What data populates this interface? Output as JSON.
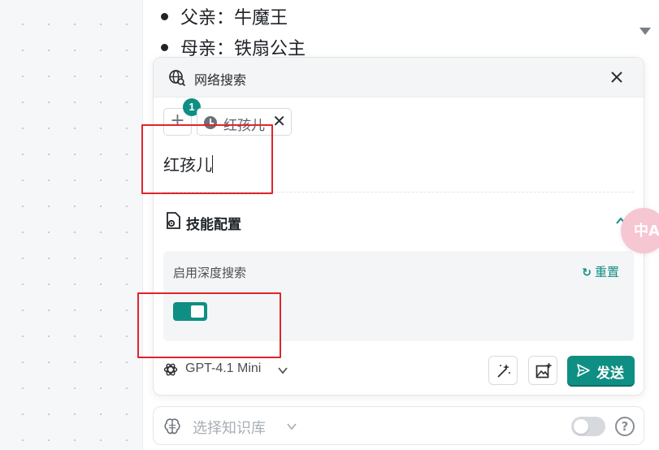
{
  "document": {
    "list_items": [
      "父亲：牛魔王",
      "母亲：铁扇公主"
    ]
  },
  "panel": {
    "title": "网络搜索",
    "title_icon": "globe-search-icon",
    "close_glyph": "✕",
    "add_glyph": "+",
    "selected_count": "1",
    "chip": {
      "icon": "history-clock-icon",
      "label": "红孩儿",
      "close_glyph": "✕"
    },
    "query_text": "红孩儿",
    "skills": {
      "title": "技能配置",
      "icon": "skill-config-icon",
      "collapse_icon": "chevron-up-icon",
      "deep_search_label": "启用深度搜索",
      "deep_search_enabled": true,
      "reset_label": "重置",
      "reset_icon_glyph": "↻"
    },
    "model": {
      "name": "GPT-4.1 Mini",
      "icon": "openai-icon"
    },
    "tools": [
      "magic-wand-icon",
      "image-add-icon"
    ],
    "send_label": "发送"
  },
  "translate_fab": {
    "glyph": "中A"
  },
  "knowledge_bar": {
    "placeholder": "选择知识库",
    "icon": "brain-icon",
    "toggle_enabled": false,
    "help_glyph": "?"
  },
  "colors": {
    "accent": "#0f8f83",
    "annotation": "#e0252b",
    "fab": "#f6c6d3"
  }
}
